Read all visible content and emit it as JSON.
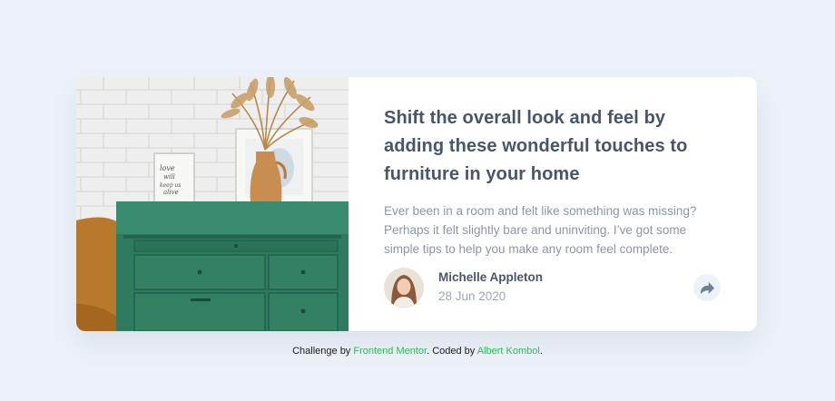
{
  "card": {
    "title": "Shift the overall look and feel by adding these wonderful touches to furniture in your home",
    "description": "Ever been in a room and felt like something was missing? Perhaps it felt slightly bare and uninviting. I’ve got some simple tips to help you make any room feel complete.",
    "image": {
      "frame_text": [
        "love",
        "will",
        "keep us",
        "alive"
      ]
    },
    "author": {
      "name": "Michelle Appleton",
      "date": "28 Jun 2020"
    },
    "share_icon": "share-icon"
  },
  "attribution": {
    "prefix": "Challenge by ",
    "challenge_link": "Frontend Mentor",
    "middle": ". Coded by ",
    "author_link": "Albert Kombol",
    "suffix": "."
  },
  "colors": {
    "background": "#ecf2f8",
    "heading": "#48556a",
    "body_text": "#8a95a8",
    "link": "#2bbc5a",
    "share_bg": "#ecf2f8",
    "share_icon": "#6e8098"
  }
}
